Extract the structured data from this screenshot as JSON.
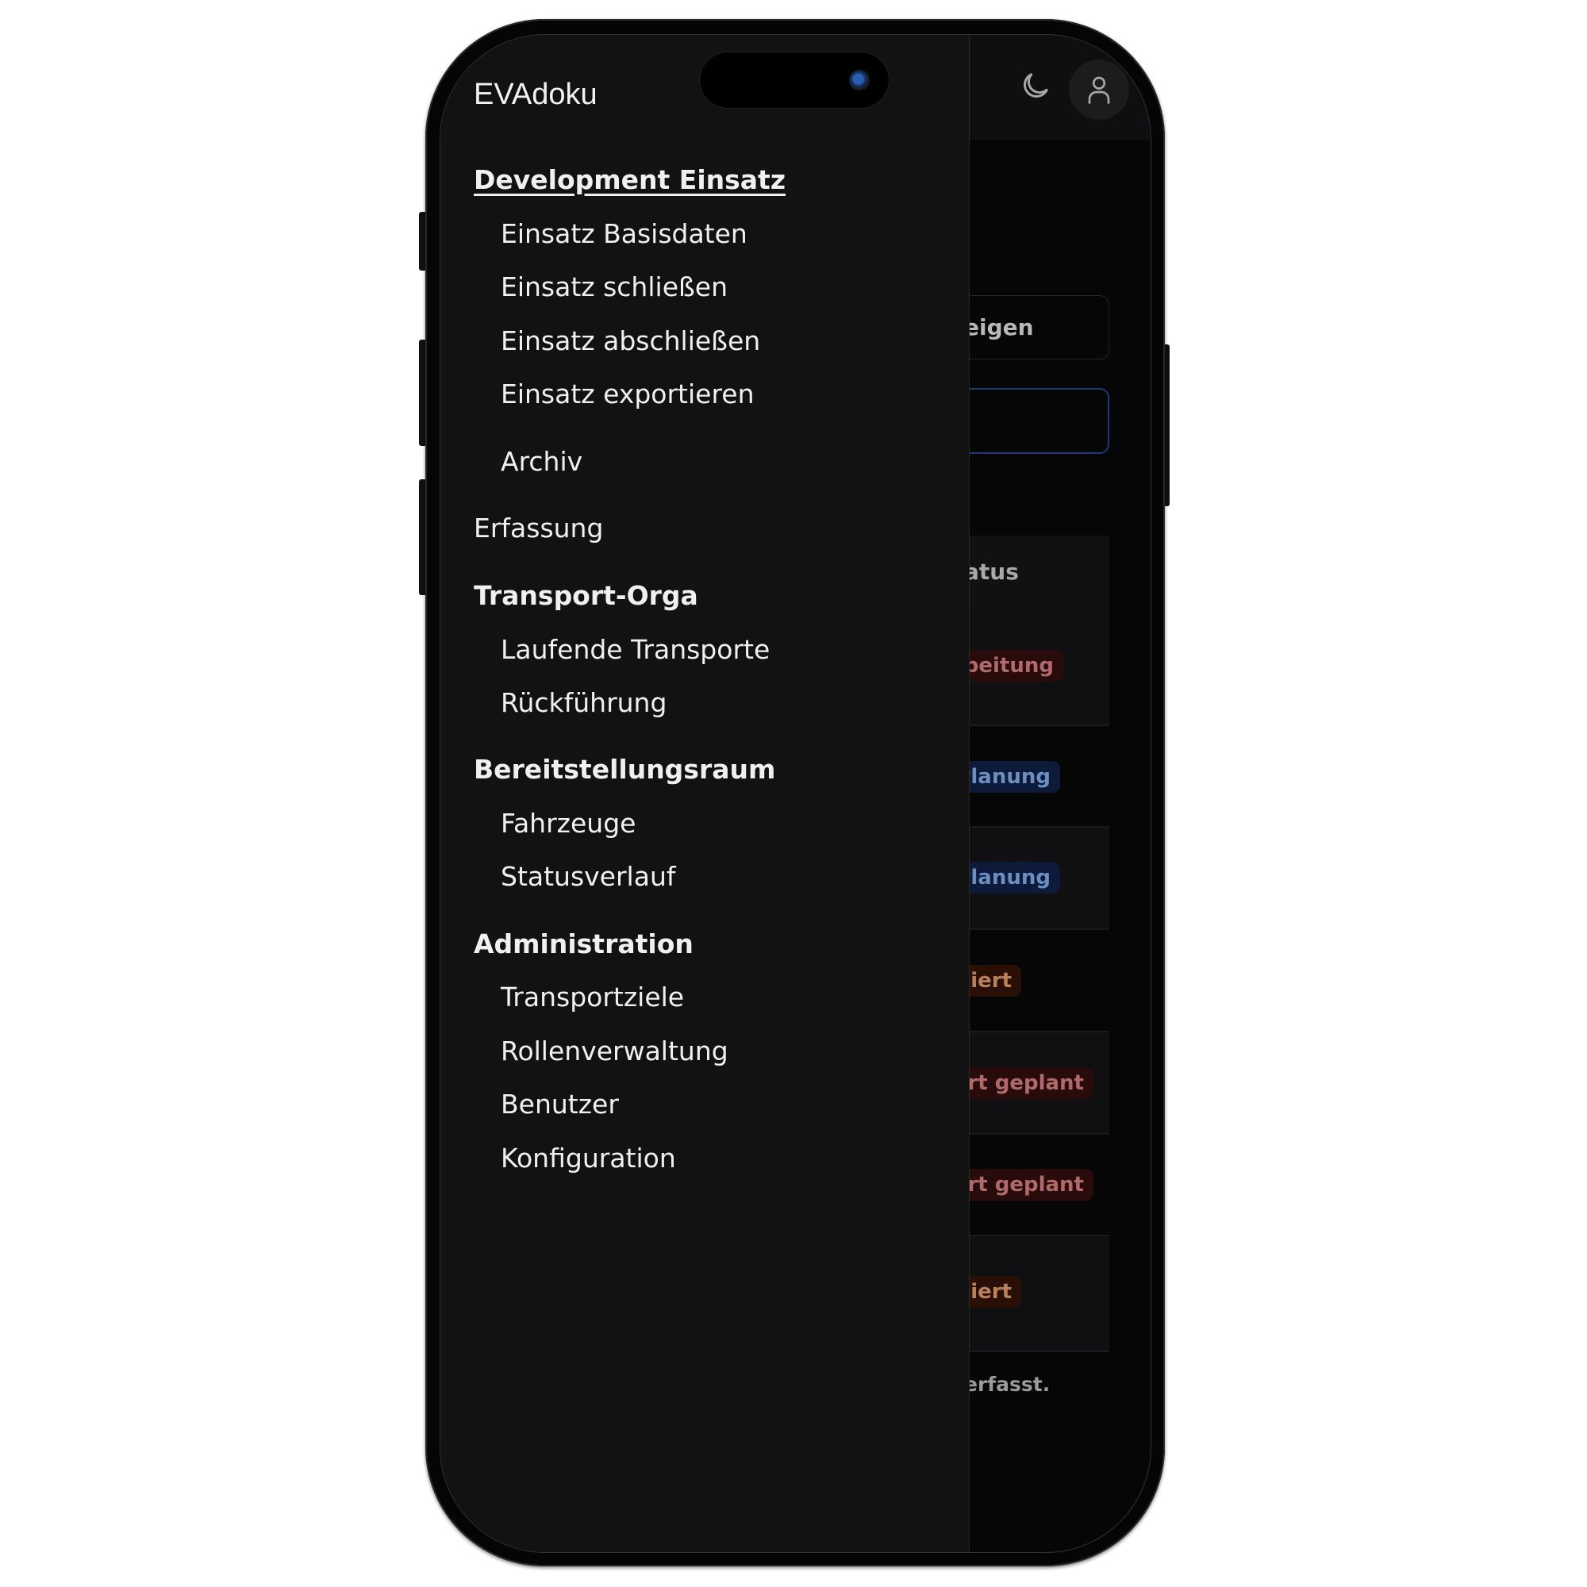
{
  "app": {
    "title": "EVAdoku"
  },
  "header": {
    "theme_toggle_icon": "moon-icon",
    "user_menu_icon": "user-icon"
  },
  "drawer": {
    "groups": [
      {
        "label": "Development Einsatz",
        "active": true,
        "items": [
          {
            "label": "Einsatz Basisdaten"
          },
          {
            "label": "Einsatz schließen"
          },
          {
            "label": "Einsatz abschließen"
          },
          {
            "label": "Einsatz exportieren"
          },
          {
            "label": "Archiv"
          }
        ]
      },
      {
        "label": "Erfassung",
        "items": []
      },
      {
        "label": "Transport-Orga",
        "items": [
          {
            "label": "Laufende Transporte"
          },
          {
            "label": "Rückführung"
          }
        ]
      },
      {
        "label": "Bereitstellungsraum",
        "items": [
          {
            "label": "Fahrzeuge"
          },
          {
            "label": "Statusverlauf"
          }
        ]
      },
      {
        "label": "Administration",
        "items": [
          {
            "label": "Transportziele"
          },
          {
            "label": "Rollenverwaltung"
          },
          {
            "label": "Benutzer"
          },
          {
            "label": "Konfiguration"
          }
        ]
      }
    ]
  },
  "background_page": {
    "button_partial_label": "eigen",
    "table": {
      "status_header_partial": "atus",
      "rows": [
        {
          "status": "n Bearbeitung",
          "color": "red"
        },
        {
          "status": "eine Planung",
          "color": "blue"
        },
        {
          "status": "eine Planung",
          "color": "blue"
        },
        {
          "status": "isponiert",
          "color": "orange"
        },
        {
          "status": "ransport geplant",
          "color": "red"
        },
        {
          "status": "ransport geplant",
          "color": "red"
        },
        {
          "status": "isponiert",
          "color": "orange"
        }
      ]
    },
    "footer_partial": "erfasst."
  },
  "colors": {
    "drawer_bg": "#121212",
    "page_bg": "#060606",
    "badge_red_text": "#b06a6a",
    "badge_blue_text": "#6c8fbf",
    "badge_orange_text": "#b8815a",
    "input_focus_border": "#1c3a7a"
  }
}
